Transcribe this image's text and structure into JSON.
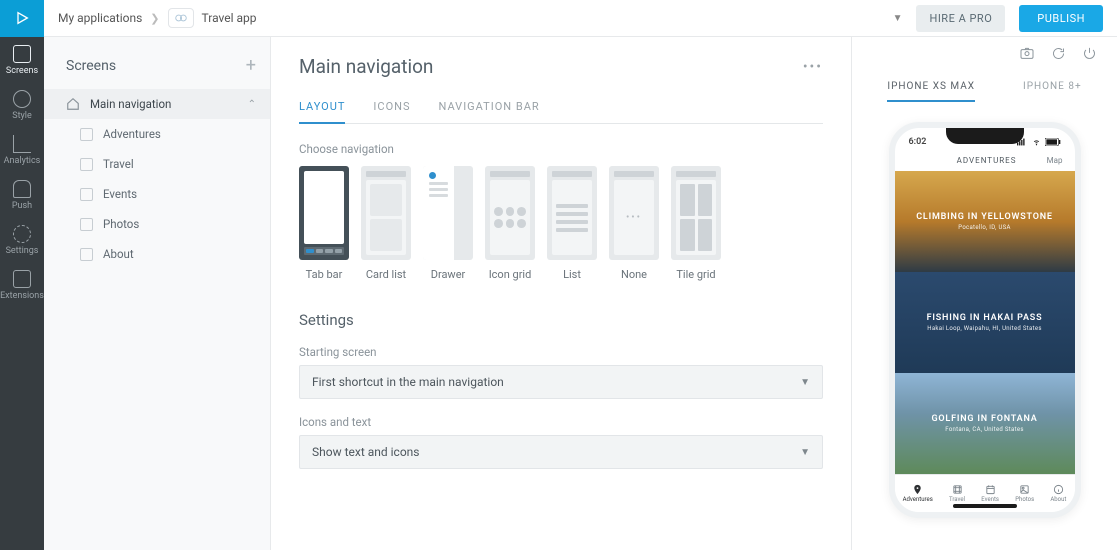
{
  "header": {
    "breadcrumb_root": "My applications",
    "app_name": "Travel app",
    "hire_pro": "HIRE A PRO",
    "publish": "PUBLISH"
  },
  "rail": [
    {
      "label": "Screens",
      "active": true
    },
    {
      "label": "Style"
    },
    {
      "label": "Analytics"
    },
    {
      "label": "Push"
    },
    {
      "label": "Settings"
    },
    {
      "label": "Extensions"
    }
  ],
  "screens": {
    "title": "Screens",
    "items": [
      {
        "label": "Main navigation",
        "type": "parent"
      },
      {
        "label": "Adventures",
        "type": "child"
      },
      {
        "label": "Travel",
        "type": "child"
      },
      {
        "label": "Events",
        "type": "child"
      },
      {
        "label": "Photos",
        "type": "child"
      },
      {
        "label": "About",
        "type": "child"
      }
    ]
  },
  "editor": {
    "title": "Main navigation",
    "tabs": [
      "LAYOUT",
      "ICONS",
      "NAVIGATION BAR"
    ],
    "choose_label": "Choose navigation",
    "layouts": [
      "Tab bar",
      "Card list",
      "Drawer",
      "Icon grid",
      "List",
      "None",
      "Tile grid"
    ],
    "settings_title": "Settings",
    "starting_label": "Starting screen",
    "starting_value": "First shortcut in the main navigation",
    "icons_label": "Icons and text",
    "icons_value": "Show text and icons"
  },
  "preview": {
    "tabs": [
      "IPHONE XS MAX",
      "IPHONE 8+"
    ],
    "clock": "6:02",
    "app_title": "ADVENTURES",
    "app_right": "Map",
    "tiles": [
      {
        "title": "CLIMBING IN YELLOWSTONE",
        "sub": "Pocatello, ID, USA",
        "bg": "linear-gradient(180deg,#d6a84e 0%,#b67a2b 50%,#2e3b45 100%)"
      },
      {
        "title": "FISHING IN HAKAI PASS",
        "sub": "Hakai Loop, Waipahu, HI, United States",
        "bg": "linear-gradient(180deg,#2b4a6e 0%,#1f3a57 100%)"
      },
      {
        "title": "GOLFING IN FONTANA",
        "sub": "Fontana, CA, United States",
        "bg": "linear-gradient(180deg,#8fb5d6 0%,#6f93a8 40%,#5e8a5a 100%)"
      }
    ],
    "bnav": [
      "Adventures",
      "Travel",
      "Events",
      "Photos",
      "About"
    ]
  }
}
